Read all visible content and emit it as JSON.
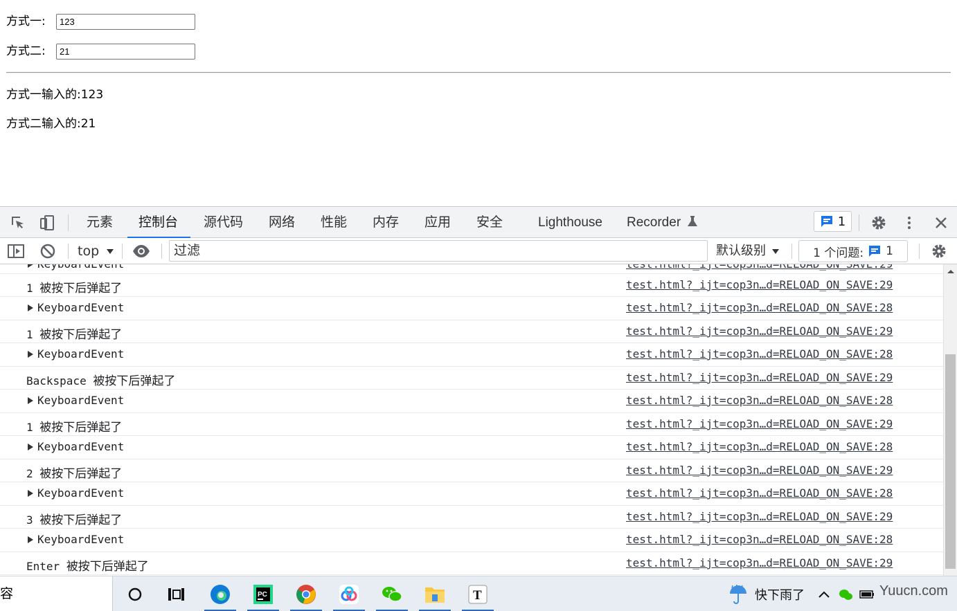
{
  "page": {
    "field1_label": "方式一:",
    "field1_value": "123",
    "field2_label": "方式二:",
    "field2_value": "21",
    "output1": "方式一输入的:123",
    "output2": "方式二输入的:21"
  },
  "devtools": {
    "tabs": [
      "元素",
      "控制台",
      "源代码",
      "网络",
      "性能",
      "内存",
      "应用",
      "安全",
      "Lighthouse",
      "Recorder"
    ],
    "active_tab": "控制台",
    "issue_badge_count": "1",
    "context": "top",
    "filter_placeholder": "过滤",
    "levels": "默认级别",
    "issues_label": "1 个问题:",
    "issues_count": "1",
    "accent": "#1a73e8"
  },
  "console": {
    "partial_row": "KeyboardEvent",
    "rows": [
      {
        "kind": "log",
        "key": "1",
        "text": "被按下后弹起了",
        "source": "test.html?_ijt=cop3n…d=RELOAD_ON_SAVE:29"
      },
      {
        "kind": "object",
        "key": "KeyboardEvent",
        "text": "",
        "source": "test.html?_ijt=cop3n…d=RELOAD_ON_SAVE:28"
      },
      {
        "kind": "log",
        "key": "1",
        "text": "被按下后弹起了",
        "source": "test.html?_ijt=cop3n…d=RELOAD_ON_SAVE:29"
      },
      {
        "kind": "object",
        "key": "KeyboardEvent",
        "text": "",
        "source": "test.html?_ijt=cop3n…d=RELOAD_ON_SAVE:28"
      },
      {
        "kind": "log",
        "key": "Backspace",
        "text": "被按下后弹起了",
        "source": "test.html?_ijt=cop3n…d=RELOAD_ON_SAVE:29"
      },
      {
        "kind": "object",
        "key": "KeyboardEvent",
        "text": "",
        "source": "test.html?_ijt=cop3n…d=RELOAD_ON_SAVE:28"
      },
      {
        "kind": "log",
        "key": "1",
        "text": "被按下后弹起了",
        "source": "test.html?_ijt=cop3n…d=RELOAD_ON_SAVE:29"
      },
      {
        "kind": "object",
        "key": "KeyboardEvent",
        "text": "",
        "source": "test.html?_ijt=cop3n…d=RELOAD_ON_SAVE:28"
      },
      {
        "kind": "log",
        "key": "2",
        "text": "被按下后弹起了",
        "source": "test.html?_ijt=cop3n…d=RELOAD_ON_SAVE:29"
      },
      {
        "kind": "object",
        "key": "KeyboardEvent",
        "text": "",
        "source": "test.html?_ijt=cop3n…d=RELOAD_ON_SAVE:28"
      },
      {
        "kind": "log",
        "key": "3",
        "text": "被按下后弹起了",
        "source": "test.html?_ijt=cop3n…d=RELOAD_ON_SAVE:29"
      },
      {
        "kind": "object",
        "key": "KeyboardEvent",
        "text": "",
        "source": "test.html?_ijt=cop3n…d=RELOAD_ON_SAVE:28"
      },
      {
        "kind": "log",
        "key": "Enter",
        "text": "被按下后弹起了",
        "source": "test.html?_ijt=cop3n…d=RELOAD_ON_SAVE:29"
      }
    ]
  },
  "taskbar": {
    "search_text": "容",
    "weather": "快下雨了",
    "watermark": "Yuucn.com"
  }
}
